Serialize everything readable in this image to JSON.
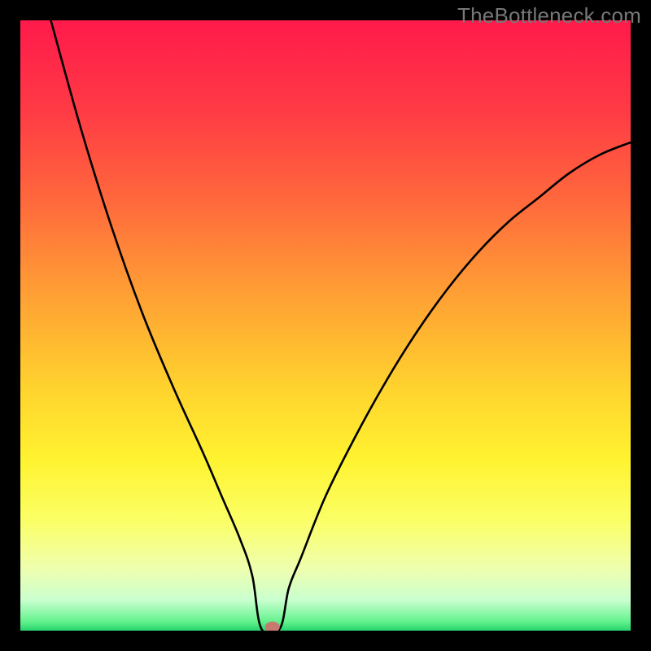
{
  "watermark": "TheBottleneck.com",
  "chart_data": {
    "type": "line",
    "title": "",
    "xlabel": "",
    "ylabel": "",
    "xlim": [
      0,
      100
    ],
    "ylim": [
      0,
      100
    ],
    "grid": false,
    "legend": false,
    "background_gradient": {
      "stops": [
        {
          "pos": 0.0,
          "color": "#ff1a4b"
        },
        {
          "pos": 0.15,
          "color": "#ff3b45"
        },
        {
          "pos": 0.3,
          "color": "#ff6a3c"
        },
        {
          "pos": 0.45,
          "color": "#ffa034"
        },
        {
          "pos": 0.6,
          "color": "#ffd22e"
        },
        {
          "pos": 0.72,
          "color": "#fff330"
        },
        {
          "pos": 0.82,
          "color": "#fbff66"
        },
        {
          "pos": 0.9,
          "color": "#eeffb0"
        },
        {
          "pos": 0.95,
          "color": "#c9ffcf"
        },
        {
          "pos": 0.985,
          "color": "#64f28e"
        },
        {
          "pos": 1.0,
          "color": "#27d36d"
        }
      ]
    },
    "curve": {
      "x": [
        5,
        10,
        15,
        20,
        25,
        30,
        33,
        36,
        38,
        39.5,
        40.5,
        41,
        41.5,
        42.5,
        44,
        46,
        50,
        55,
        60,
        65,
        70,
        75,
        80,
        85,
        90,
        95,
        100
      ],
      "y": [
        100,
        82,
        66,
        52,
        40,
        29,
        22,
        15,
        9,
        4,
        1,
        0.5,
        1,
        3,
        7,
        12,
        22,
        32,
        41,
        49,
        56,
        62,
        67,
        71,
        75,
        78,
        80
      ],
      "flat_segment": {
        "x0": 39.5,
        "x1": 42.5,
        "y": 0.3
      }
    },
    "marker": {
      "x": 41.3,
      "y": 0.6,
      "rx": 1.2,
      "ry": 0.9,
      "color": "#c77a6f"
    }
  }
}
